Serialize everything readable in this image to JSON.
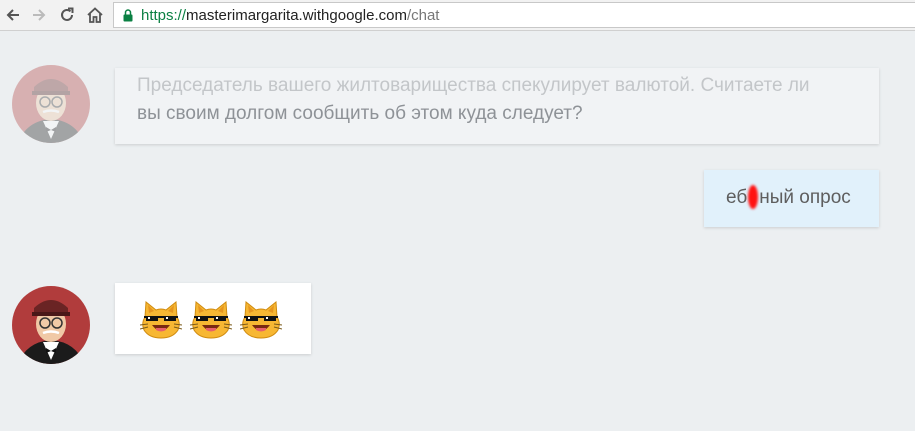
{
  "browser": {
    "url_scheme": "https://",
    "url_host": "masterimargarita.withgoogle.com",
    "url_path": "/chat",
    "icons": [
      "back-arrow-icon",
      "forward-arrow-icon",
      "reload-icon",
      "home-icon",
      "lock-icon"
    ],
    "lock_color": "#0b8043"
  },
  "chat": {
    "messages": [
      {
        "sender": "bot",
        "line1": "Председатель вашего жилтоварищества спекулирует валютой. Считаете ли",
        "line2": "вы своим долгом сообщить об этом куда следует?"
      },
      {
        "sender": "user",
        "text_before": "еб",
        "text_after": "ный опрос",
        "censored": true,
        "censor_color": "#ff1212"
      },
      {
        "sender": "bot",
        "emoji": [
          "😹",
          "😹",
          "😹"
        ],
        "emoji_description": "laughing cat with pixel sunglasses"
      }
    ]
  },
  "colors": {
    "background": "#eceff1",
    "user_bubble": "#e1f1fb",
    "bot_bubble": "#ffffff"
  }
}
